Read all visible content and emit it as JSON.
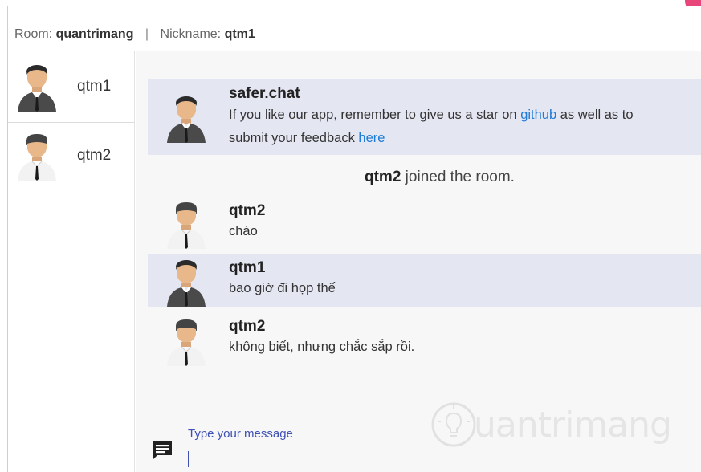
{
  "header": {
    "room_label": "Room:",
    "room_name": "quantrimang",
    "separator": "|",
    "nickname_label": "Nickname:",
    "nickname": "qtm1"
  },
  "sidebar": {
    "users": [
      {
        "name": "qtm1",
        "avatar": "man-dark-suit-avatar"
      },
      {
        "name": "qtm2",
        "avatar": "man-white-shirt-avatar"
      }
    ]
  },
  "messages": [
    {
      "author": "safer.chat",
      "line1_pre": "If you like our app, remember to give us a star on ",
      "line1_link": "github",
      "line1_post": " as well as to",
      "line2_pre": "submit your feedback ",
      "line2_link": "here"
    },
    {
      "author": "qtm2",
      "text": "chào"
    },
    {
      "author": "qtm1",
      "text": "bao giờ đi họp thế"
    },
    {
      "author": "qtm2",
      "text": "không biết, nhưng chắc sắp rồi."
    }
  ],
  "system": {
    "user": "qtm2",
    "text": " joined the room."
  },
  "composer": {
    "label": "Type your message",
    "value": ""
  },
  "watermark": {
    "text": "uantrimang"
  },
  "colors": {
    "link": "#1e7bd6",
    "highlight": "#e4e6f2",
    "accent": "#3f51b5"
  }
}
